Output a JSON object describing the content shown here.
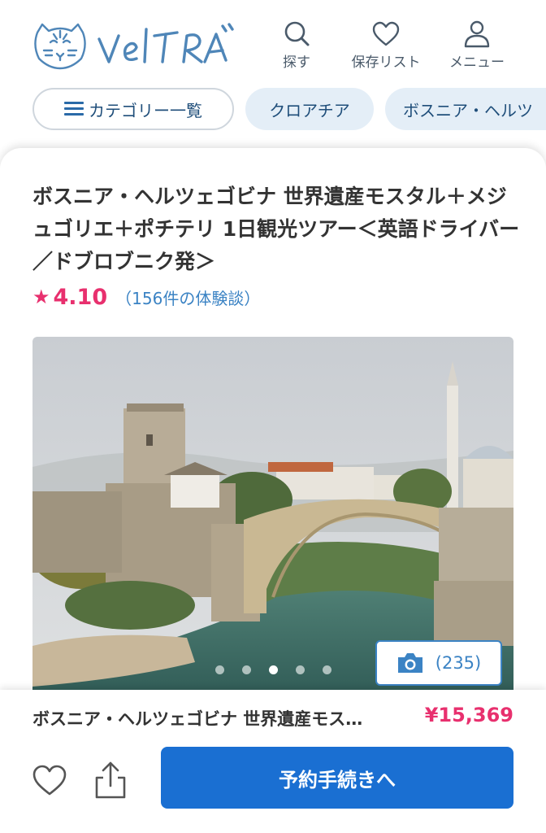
{
  "header": {
    "logo_text": "VELTRA",
    "nav": [
      {
        "label": "探す",
        "icon": "search-icon"
      },
      {
        "label": "保存リスト",
        "icon": "heart-icon"
      },
      {
        "label": "メニュー",
        "icon": "user-icon"
      }
    ]
  },
  "categories": {
    "all_label": "カテゴリー一覧",
    "chips": [
      "クロアチア",
      "ボスニア・ヘルツ"
    ]
  },
  "tour": {
    "title": "ボスニア・ヘルツェゴビナ 世界遺産モスタル＋メジュゴリエ＋ポチテリ 1日観光ツアー＜英語ドライバー／ドブロブニク発＞",
    "rating": "4.10",
    "reviews": "（156件の体験談）",
    "photo_count": "(235)",
    "carousel": {
      "total": 5,
      "active_index": 3
    }
  },
  "booking": {
    "name": "ボスニア・ヘルツェゴビナ 世界遺産モス…",
    "price": "¥15,369",
    "button_label": "予約手続きへ"
  },
  "colors": {
    "accent_pink": "#e8306e",
    "link_blue": "#3b83c4",
    "button_blue": "#1a6fd2",
    "chip_bg": "#e4eef7"
  }
}
